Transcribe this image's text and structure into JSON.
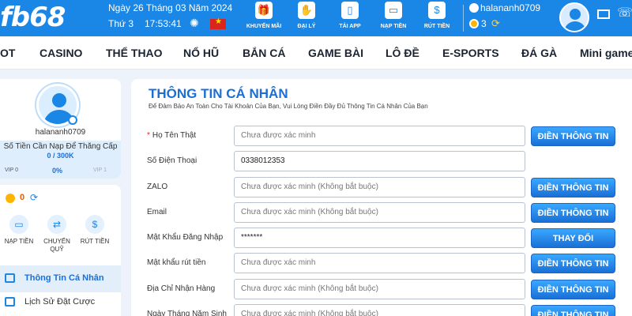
{
  "header": {
    "logo": "fb68",
    "date": "Ngày 26 Tháng 03 Năm 2024",
    "weekday": "Thứ 3",
    "time": "17:53:41",
    "buttons": [
      {
        "label": "KHUYẾN MÃI",
        "icon": "gift-icon"
      },
      {
        "label": "ĐẠI LÝ",
        "icon": "handshake-icon"
      },
      {
        "label": "TẢI APP",
        "icon": "mobile-icon"
      },
      {
        "label": "NẠP TIỀN",
        "icon": "wallet-icon"
      },
      {
        "label": "RÚT TIỀN",
        "icon": "money-bag-icon"
      }
    ],
    "username": "halananh0709",
    "balance": "3"
  },
  "nav": [
    "OT",
    "CASINO",
    "THỂ THAO",
    "NỔ HŨ",
    "BẮN CÁ",
    "GAME BÀI",
    "LÔ ĐỀ",
    "E-SPORTS",
    "ĐÁ GÀ",
    "Mini game"
  ],
  "sidebar": {
    "username": "halananh0709",
    "deposit_label": "Số Tiền Cần Nạp Để Thăng Cấp",
    "deposit_value": "0 / 300K",
    "vip_current": "VIP 0",
    "vip_progress": "0%",
    "vip_next": "VIP 1",
    "balance": "0",
    "actions": [
      {
        "label": "NẠP TIỀN",
        "icon": "wallet-icon"
      },
      {
        "label": "CHUYỂN QUỸ",
        "icon": "transfer-icon"
      },
      {
        "label": "RÚT TIỀN",
        "icon": "money-bag-icon"
      }
    ],
    "menu": [
      {
        "label": "Thông Tin Cá Nhân",
        "icon": "id-card-icon",
        "active": true
      },
      {
        "label": "Lịch Sử Đặt Cược",
        "icon": "history-icon",
        "active": false
      }
    ]
  },
  "main": {
    "title": "THÔNG TIN CÁ NHÂN",
    "subtitle": "Để Đảm Bảo An Toàn Cho Tài Khoản Của Bạn, Vui Lòng Điền Đầy Đủ Thông Tin Cá Nhân Của Bạn",
    "rows": [
      {
        "label": "Họ Tên Thật",
        "required": "*",
        "value": "Chưa được xác minh",
        "button": "ĐIỀN THÔNG TIN"
      },
      {
        "label": "Số Điện Thoại",
        "value": "0338012353",
        "button": ""
      },
      {
        "label": "ZALO",
        "value": "Chưa được xác minh (Không bắt buộc)",
        "button": "ĐIỀN THÔNG TIN"
      },
      {
        "label": "Email",
        "value": "Chưa được xác minh (Không bắt buộc)",
        "button": "ĐIỀN THÔNG TIN"
      },
      {
        "label": "Mật Khẩu Đăng Nhập",
        "value": "*******",
        "button": "THAY ĐỔI"
      },
      {
        "label": "Mật khẩu rút tiền",
        "value": "Chưa được xác minh",
        "button": "ĐIỀN THÔNG TIN"
      },
      {
        "label": "Địa Chỉ Nhận Hàng",
        "value": "Chưa được xác minh (Không bắt buộc)",
        "button": "ĐIỀN THÔNG TIN"
      },
      {
        "label": "Ngày Tháng Năm Sinh",
        "value": "Chưa được xác minh (Không bắt buộc)",
        "button": "ĐIỀN THÔNG TIN"
      }
    ]
  },
  "colors": {
    "primary": "#1a86e6",
    "title": "#1a6fd6",
    "background": "#eef3fb"
  }
}
